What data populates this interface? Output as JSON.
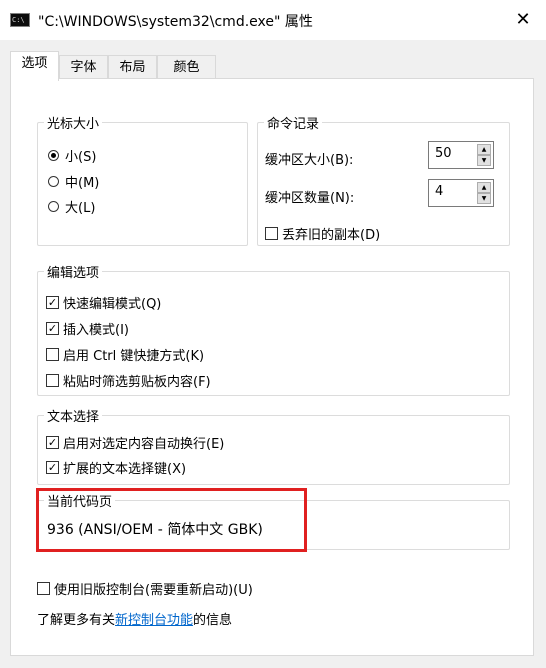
{
  "window": {
    "title": "\"C:\\WINDOWS\\system32\\cmd.exe\" 属性",
    "icon": "cmd-icon",
    "close_glyph": "✕"
  },
  "tabs": [
    "选项",
    "字体",
    "布局",
    "颜色"
  ],
  "active_tab": "选项",
  "cursor_size": {
    "legend": "光标大小",
    "options": [
      "小(S)",
      "中(M)",
      "大(L)"
    ],
    "selected": "小(S)"
  },
  "command_history": {
    "legend": "命令记录",
    "buffer_size_label": "缓冲区大小(B):",
    "buffer_size_value": "50",
    "buffer_count_label": "缓冲区数量(N):",
    "buffer_count_value": "4",
    "discard_old_label": "丢弃旧的副本(D)",
    "discard_old_checked": false
  },
  "edit_options": {
    "legend": "编辑选项",
    "items": [
      {
        "label": "快速编辑模式(Q)",
        "checked": true
      },
      {
        "label": "插入模式(I)",
        "checked": true
      },
      {
        "label": "启用 Ctrl 键快捷方式(K)",
        "checked": false
      },
      {
        "label": "粘贴时筛选剪贴板内容(F)",
        "checked": false
      }
    ]
  },
  "text_selection": {
    "legend": "文本选择",
    "items": [
      {
        "label": "启用对选定内容自动换行(E)",
        "checked": true
      },
      {
        "label": "扩展的文本选择键(X)",
        "checked": true
      }
    ]
  },
  "code_page": {
    "legend": "当前代码页",
    "value": "936   (ANSI/OEM - 简体中文 GBK)",
    "highlight_color": "#e02020"
  },
  "legacy_console": {
    "label": "使用旧版控制台(需要重新启动)(U)",
    "checked": false
  },
  "learn_more": {
    "prefix": "了解更多有关",
    "link": "新控制台功能",
    "suffix": "的信息"
  },
  "colors": {
    "dialog_bg": "#f0f0f0",
    "panel_bg": "#ffffff",
    "link": "#0066cc"
  }
}
